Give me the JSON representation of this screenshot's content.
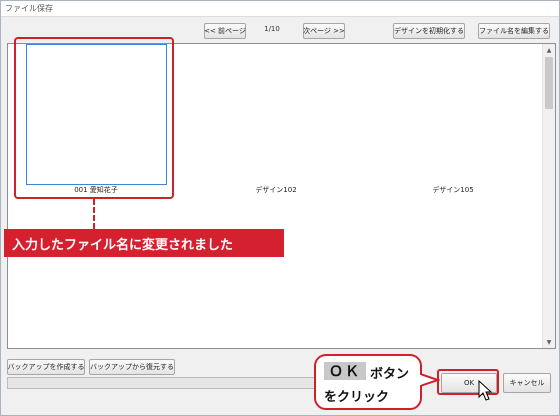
{
  "window": {
    "title": "ファイル保存"
  },
  "toolbar": {
    "prev_label": "<< 前ページ",
    "page_indicator": "1/10",
    "next_label": "次ページ >>",
    "init_design_label": "デザインを初期化する",
    "edit_filename_label": "ファイル名を編集する"
  },
  "designs": [
    {
      "label": "001 愛知花子"
    },
    {
      "label": "デザイン102"
    },
    {
      "label": "デザイン105"
    }
  ],
  "annotations": {
    "renamed_banner": "入力したファイル名に変更されました",
    "callout_ok": "ＯＫ",
    "callout_line1": "ボタン",
    "callout_line2": "をクリック"
  },
  "footer": {
    "backup_create_label": "バックアップを作成する",
    "backup_restore_label": "バックアップから復元する",
    "ok_label": "OK",
    "cancel_label": "キャンセル"
  },
  "colors": {
    "accent": "#d0202a",
    "selection": "#3c86d8"
  }
}
